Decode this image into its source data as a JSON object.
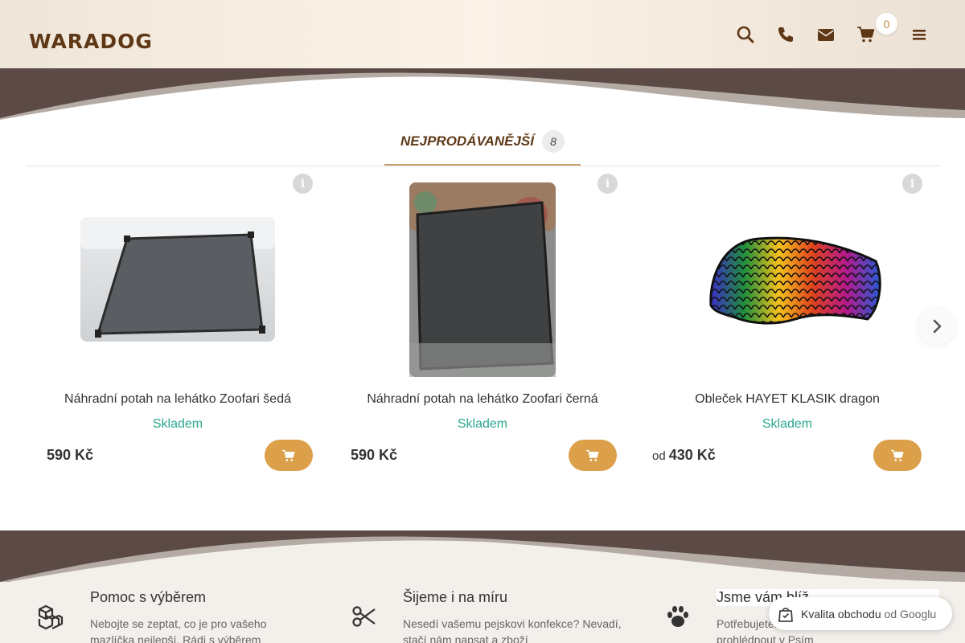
{
  "header": {
    "logo": "WARADOG",
    "icons": [
      "search-icon",
      "phone-icon",
      "envelope-icon",
      "cart-icon",
      "menu-icon"
    ],
    "cart_count": "0"
  },
  "tabs": [
    {
      "label": "NEJPRODÁVANĚJŠÍ",
      "count": "8"
    }
  ],
  "products": [
    {
      "name": "Náhradní potah na lehátko Zoofari šedá",
      "stock": "Skladem",
      "price_prefix": "",
      "price": "590 Kč"
    },
    {
      "name": "Náhradní potah na lehátko Zoofari černá",
      "stock": "Skladem",
      "price_prefix": "",
      "price": "590 Kč"
    },
    {
      "name": "Obleček HAYET KLASIK dragon",
      "stock": "Skladem",
      "price_prefix": "od",
      "price": "430 Kč"
    }
  ],
  "features": [
    {
      "title": "Pomoc s výběrem",
      "text": "Nebojte se zeptat, co je pro vašeho mazlíčka nejlepší. Rádi s výběrem",
      "icon": "boxes-icon"
    },
    {
      "title": "Šijeme i na míru",
      "text": "Nesedí vašemu pejskovi konfekce? Nevadí, stačí nám napsat a zboží",
      "icon": "scissors-icon"
    },
    {
      "title": "Jsme vám blíž",
      "text": "Potřebujete... nich si můžete osobně prohlédnout v Psím",
      "icon": "paw-icon"
    }
  ],
  "google_badge": {
    "label": "Kvalita obchodu",
    "suffix": "od Googlu"
  },
  "colors": {
    "brand_brown": "#5e3816",
    "accent_gold": "#dca04a",
    "stock_green": "#2aa88b",
    "wave_dark": "#5b4a45",
    "wave_light": "#b5aba5"
  }
}
